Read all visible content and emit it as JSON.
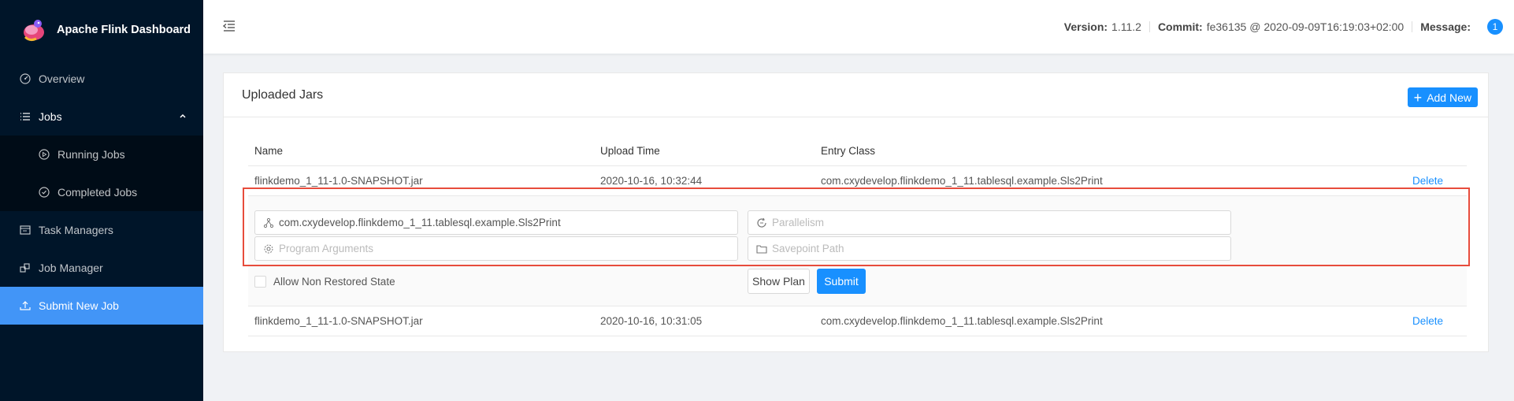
{
  "app": {
    "title": "Apache Flink Dashboard"
  },
  "sidebar": {
    "items": [
      {
        "label": "Overview",
        "icon": "dashboard-icon"
      },
      {
        "label": "Jobs",
        "icon": "list-icon"
      },
      {
        "label": "Running Jobs",
        "icon": "play-circle-icon"
      },
      {
        "label": "Completed Jobs",
        "icon": "check-circle-icon"
      },
      {
        "label": "Task Managers",
        "icon": "schedule-icon"
      },
      {
        "label": "Job Manager",
        "icon": "build-icon"
      },
      {
        "label": "Submit New Job",
        "icon": "upload-icon"
      }
    ]
  },
  "header": {
    "version_label": "Version:",
    "version_value": "1.11.2",
    "commit_label": "Commit:",
    "commit_value": "fe36135 @ 2020-09-09T16:19:03+02:00",
    "message_label": "Message:",
    "message_count": "1"
  },
  "card": {
    "title": "Uploaded Jars",
    "add_label": "Add New"
  },
  "table": {
    "columns": [
      "Name",
      "Upload Time",
      "Entry Class"
    ],
    "rows": [
      {
        "name": "flinkdemo_1_11-1.0-SNAPSHOT.jar",
        "upload_time": "2020-10-16, 10:32:44",
        "entry_class": "com.cxydevelop.flinkdemo_1_11.tablesql.example.Sls2Print",
        "action": "Delete"
      },
      {
        "name": "flinkdemo_1_11-1.0-SNAPSHOT.jar",
        "upload_time": "2020-10-16, 10:31:05",
        "entry_class": "com.cxydevelop.flinkdemo_1_11.tablesql.example.Sls2Print",
        "action": "Delete"
      }
    ]
  },
  "form": {
    "entry_class_value": "com.cxydevelop.flinkdemo_1_11.tablesql.example.Sls2Print",
    "parallelism_placeholder": "Parallelism",
    "program_args_placeholder": "Program Arguments",
    "savepoint_placeholder": "Savepoint Path",
    "allow_non_restored_label": "Allow Non Restored State",
    "show_plan_label": "Show Plan",
    "submit_label": "Submit"
  },
  "colors": {
    "sidebar_bg": "#001529",
    "accent": "#1890ff",
    "highlight_border": "#e74c3c"
  }
}
